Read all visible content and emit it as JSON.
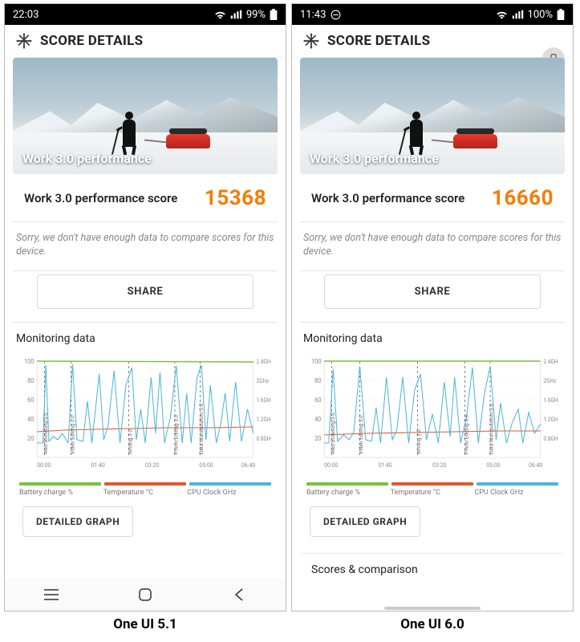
{
  "left": {
    "status": {
      "time": "22:03",
      "battery": "99%"
    },
    "header": {
      "title": "SCORE DETAILS"
    },
    "banner": {
      "label": "Work 3.0 performance"
    },
    "score": {
      "label": "Work 3.0 performance score",
      "value": "15368"
    },
    "message": "Sorry, we don't have enough data to compare scores for this device.",
    "buttons": {
      "share": "SHARE",
      "detailedGraph": "DETAILED GRAPH"
    },
    "monitoring": {
      "title": "Monitoring data"
    },
    "legend": {
      "a": "Battery charge %",
      "b": "Temperature °C",
      "c": "CPU Clock GHz"
    },
    "caption": "One UI 5.1",
    "chart_data": {
      "type": "line",
      "xlabel": "",
      "ylabel_left": "%",
      "ylabel_right": "GHz",
      "x_ticks": [
        "00:00",
        "01:40",
        "03:20",
        "05:00",
        "06:40"
      ],
      "y_left_ticks": [
        20,
        40,
        60,
        80,
        100
      ],
      "y_right_ticks": [
        "0.8GHz",
        "1.2GHz",
        "1.6GHz",
        "2GHz",
        "2.4GHz"
      ],
      "ylim_left": [
        10,
        100
      ],
      "ylim_right": [
        0.4,
        2.6
      ],
      "markers": [
        {
          "label": "Web Browsing 3.0",
          "x": "00:10"
        },
        {
          "label": "Video Editing 3.0",
          "x": "00:55"
        },
        {
          "label": "Writing 3.0",
          "x": "02:40"
        },
        {
          "label": "Photo Editing 3.0",
          "x": "04:05"
        },
        {
          "label": "Data Manipulation 3.0",
          "x": "04:50"
        }
      ],
      "series": [
        {
          "name": "Battery charge %",
          "color": "#73c43c",
          "approx_values": [
            100,
            100,
            100,
            100,
            99,
            99,
            99,
            99,
            99,
            99,
            99,
            99
          ]
        },
        {
          "name": "Temperature °C",
          "color": "#e4572e",
          "approx_values": [
            33,
            34,
            35,
            35,
            36,
            36,
            36,
            37,
            37,
            37,
            37,
            37
          ]
        },
        {
          "name": "CPU Clock GHz",
          "color": "#4ab6d9",
          "approx_values": [
            0.8,
            2.4,
            0.9,
            1.0,
            2.3,
            1.0,
            2.2,
            1.1,
            2.4,
            1.2,
            1.8,
            1.0,
            2.0,
            0.9,
            1.6,
            1.0
          ]
        }
      ]
    }
  },
  "right": {
    "status": {
      "time": "11:43",
      "battery": "100%"
    },
    "header": {
      "title": "SCORE DETAILS"
    },
    "banner": {
      "label": "Work 3.0 performance"
    },
    "score": {
      "label": "Work 3.0 performance score",
      "value": "16660"
    },
    "message": "Sorry, we don't have enough data to compare scores for this device.",
    "buttons": {
      "share": "SHARE",
      "detailedGraph": "DETAILED GRAPH"
    },
    "monitoring": {
      "title": "Monitoring data"
    },
    "legend": {
      "a": "Battery charge %",
      "b": "Temperature °C",
      "c": "CPU Clock GHz"
    },
    "scoresComp": "Scores & comparison",
    "caption": "One UI 6.0",
    "chart_data": {
      "type": "line",
      "xlabel": "",
      "ylabel_left": "%",
      "ylabel_right": "GHz",
      "x_ticks": [
        "00:00",
        "01:40",
        "03:20",
        "05:00",
        "06:40"
      ],
      "y_left_ticks": [
        20,
        40,
        60,
        80,
        100
      ],
      "y_right_ticks": [
        "0.8GHz",
        "1.2GHz",
        "1.6GHz",
        "2GHz",
        "2.4GHz"
      ],
      "ylim_left": [
        10,
        100
      ],
      "ylim_right": [
        0.4,
        2.6
      ],
      "markers": [
        {
          "label": "Web Browsing 3.0",
          "x": "00:10"
        },
        {
          "label": "Video Editing 3.0",
          "x": "00:58"
        },
        {
          "label": "Writing 3.0",
          "x": "02:45"
        },
        {
          "label": "Photo Editing 3.0",
          "x": "04:10"
        },
        {
          "label": "Data Manipulation 3.0",
          "x": "04:55"
        }
      ],
      "series": [
        {
          "name": "Battery charge %",
          "color": "#73c43c",
          "approx_values": [
            100,
            100,
            100,
            100,
            100,
            100,
            100,
            100,
            100,
            100,
            100,
            100
          ]
        },
        {
          "name": "Temperature °C",
          "color": "#e4572e",
          "approx_values": [
            31,
            32,
            33,
            33,
            34,
            34,
            34,
            34,
            35,
            35,
            35,
            35
          ]
        },
        {
          "name": "CPU Clock GHz",
          "color": "#4ab6d9",
          "approx_values": [
            0.8,
            2.2,
            0.9,
            1.0,
            2.0,
            0.9,
            1.6,
            1.0,
            2.4,
            1.1,
            1.4,
            1.0,
            1.2,
            1.1,
            1.3,
            1.0
          ]
        }
      ]
    }
  }
}
